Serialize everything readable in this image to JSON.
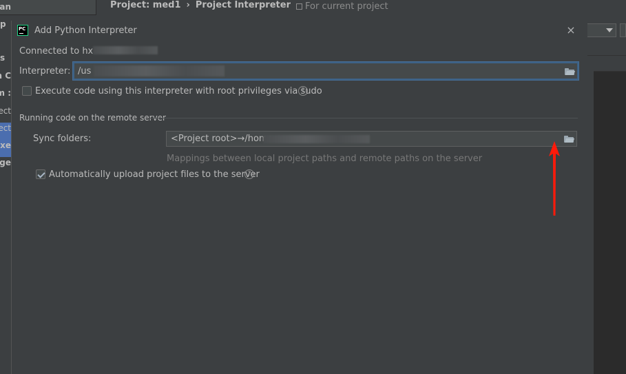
{
  "background": {
    "breadcrumb": [
      "Project: med1",
      "Project Interpreter"
    ],
    "breadcrumb_sep": "›",
    "for_current_project": "For current project",
    "sidebar_fragments": [
      "an",
      "p",
      "s",
      "n C",
      ": m",
      "ect",
      "ect",
      "Exe",
      "ge"
    ]
  },
  "dialog": {
    "title": "Add Python Interpreter",
    "close_glyph": "×",
    "connected_label": "Connected to hx",
    "interpreter_label": "Interpreter:",
    "interpreter_value": "/us",
    "sudo_label": "Execute code using this interpreter with root privileges via sudo",
    "sudo_checked": false,
    "section_title": "Running code on the remote server",
    "sync_label": "Sync folders:",
    "sync_value": "<Project root>→/home",
    "sync_hint": "Mappings between local project paths and remote paths on the server",
    "auto_upload_label": "Automatically upload project files to the server",
    "auto_upload_checked": true,
    "help_glyph": "?"
  },
  "annotation": {
    "arrow_color": "#ff1a0a"
  },
  "icons": [
    "pycharm-logo-icon",
    "close-icon",
    "folder-icon",
    "help-icon",
    "checkmark-icon",
    "chevron-down-icon"
  ]
}
